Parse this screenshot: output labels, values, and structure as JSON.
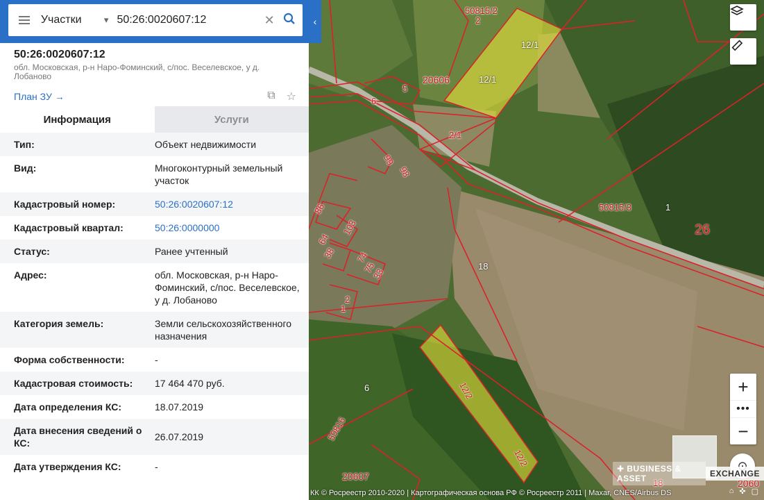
{
  "search": {
    "category": "Участки",
    "value": "50:26:0020607:12"
  },
  "header": {
    "title": "50:26:0020607:12",
    "subtitle": "обл. Московская, р-н Наро-Фоминский, с/пос. Веселевское, у д. Лобаново",
    "plan_link": "План ЗУ →"
  },
  "tabs": [
    {
      "label": "Информация",
      "active": true
    },
    {
      "label": "Услуги",
      "active": false
    }
  ],
  "info": [
    {
      "key": "Тип:",
      "value": "Объект недвижимости"
    },
    {
      "key": "Вид:",
      "value": "Многоконтурный земельный участок"
    },
    {
      "key": "Кадастровый номер:",
      "value": "50:26:0020607:12",
      "link": true
    },
    {
      "key": "Кадастровый квартал:",
      "value": "50:26:0000000",
      "link": true
    },
    {
      "key": "Статус:",
      "value": "Ранее учтенный"
    },
    {
      "key": "Адрес:",
      "value": "обл. Московская, р-н Наро-Фоминский, с/пос. Веселевское, у д. Лобаново"
    },
    {
      "key": "Категория земель:",
      "value": "Земли сельскохозяйственного назначения"
    },
    {
      "key": "Форма собственности:",
      "value": "-"
    },
    {
      "key": "Кадастровая стоимость:",
      "value": "17 464 470 руб."
    },
    {
      "key": "Дата определения КС:",
      "value": "18.07.2019"
    },
    {
      "key": "Дата внесения сведений о КС:",
      "value": "26.07.2019"
    },
    {
      "key": "Дата утверждения КС:",
      "value": "-"
    }
  ],
  "map": {
    "labels": {
      "l1": "50815/2",
      "l2": "2",
      "l3": "12/1",
      "l4": "12/1",
      "l5": "20606",
      "l6": "5",
      "l7": "6",
      "l8": "2/1",
      "l9": "99",
      "l10": "98",
      "l11": "50815/3",
      "l12": "1",
      "l13": "26",
      "l14": "86",
      "l15": "103",
      "l16": "64",
      "l17": "38",
      "l18": "74",
      "l19": "75",
      "l20": "33",
      "l21": "18",
      "l22": "2",
      "l23": "1",
      "l24": "6",
      "l25": "12/2",
      "l26": "12/2",
      "l27": "50816",
      "l28": "20607",
      "l29": "18",
      "l30": "2060"
    },
    "watermark_left": "✚ BUSINESS & ASSET",
    "watermark_right": "EXCHANGE",
    "attribution": "КК © Росреестр 2010-2020 | Картографическая основа РФ © Росреестр 2011 | Maxar, CNES/Airbus DS",
    "colors": {
      "boundary": "#d8232a",
      "highlight": "#e8e23a",
      "accent": "#2a70c7"
    }
  }
}
